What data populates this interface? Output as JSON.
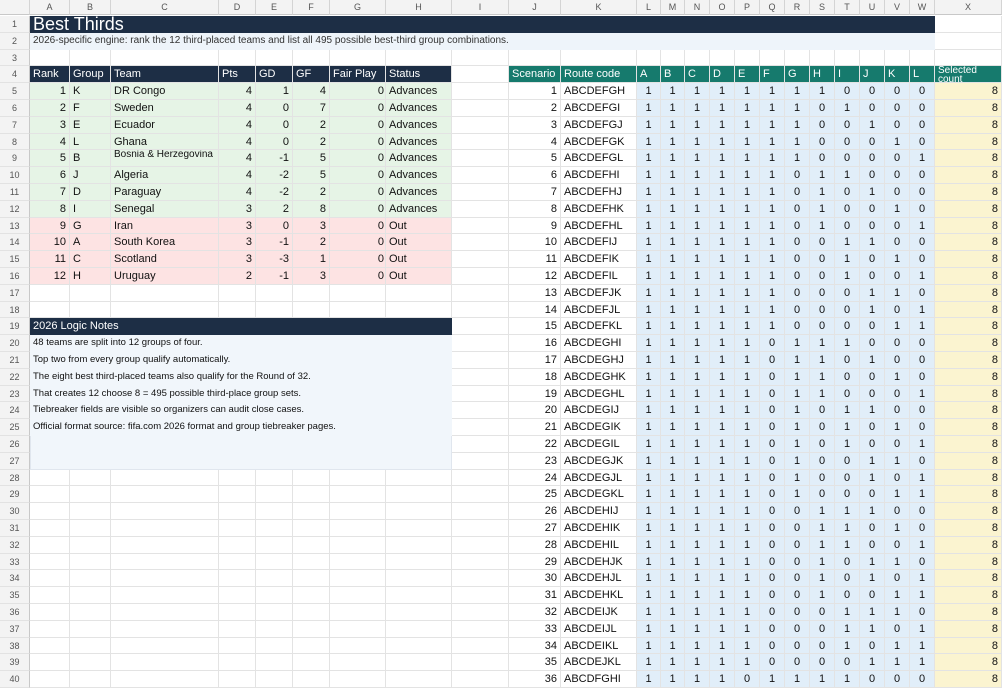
{
  "columns": [
    "A",
    "B",
    "C",
    "D",
    "E",
    "F",
    "G",
    "H",
    "I",
    "J",
    "K",
    "L",
    "M",
    "N",
    "O",
    "P",
    "Q",
    "R",
    "S",
    "T",
    "U",
    "V",
    "W",
    "X"
  ],
  "rows": 40,
  "title": "Best Thirds",
  "subtitle": "2026-specific engine: rank the 12 third-placed teams and list all 495 possible best-third group combinations.",
  "standings": {
    "headers": [
      "Rank",
      "Group",
      "Team",
      "Pts",
      "GD",
      "GF",
      "Fair Play",
      "Status"
    ],
    "rows": [
      [
        1,
        "K",
        "DR Congo",
        4,
        1,
        4,
        0,
        "Advances"
      ],
      [
        2,
        "F",
        "Sweden",
        4,
        0,
        7,
        0,
        "Advances"
      ],
      [
        3,
        "E",
        "Ecuador",
        4,
        0,
        2,
        0,
        "Advances"
      ],
      [
        4,
        "L",
        "Ghana",
        4,
        0,
        2,
        0,
        "Advances"
      ],
      [
        5,
        "B",
        "Bosnia & Herzegovina",
        4,
        -1,
        5,
        0,
        "Advances"
      ],
      [
        6,
        "J",
        "Algeria",
        4,
        -2,
        5,
        0,
        "Advances"
      ],
      [
        7,
        "D",
        "Paraguay",
        4,
        -2,
        2,
        0,
        "Advances"
      ],
      [
        8,
        "I",
        "Senegal",
        3,
        2,
        8,
        0,
        "Advances"
      ],
      [
        9,
        "G",
        "Iran",
        3,
        0,
        3,
        0,
        "Out"
      ],
      [
        10,
        "A",
        "South Korea",
        3,
        -1,
        2,
        0,
        "Out"
      ],
      [
        11,
        "C",
        "Scotland",
        3,
        -3,
        1,
        0,
        "Out"
      ],
      [
        12,
        "H",
        "Uruguay",
        2,
        -1,
        3,
        0,
        "Out"
      ]
    ]
  },
  "notes": {
    "title": "2026 Logic Notes",
    "lines": [
      "48 teams are split into 12 groups of four.",
      "Top two from every group qualify automatically.",
      "The eight best third-placed teams also qualify for the Round of 32.",
      "That creates 12 choose 8 = 495 possible third-place group sets.",
      "Tiebreaker fields are visible so organizers can audit close cases.",
      "Official format source: fifa.com 2026 format and group tiebreaker pages."
    ]
  },
  "scenarios": {
    "headers": [
      "Scenario",
      "Route code",
      "A",
      "B",
      "C",
      "D",
      "E",
      "F",
      "G",
      "H",
      "I",
      "J",
      "K",
      "L",
      "Selected count"
    ],
    "rows": [
      [
        1,
        "ABCDEFGH",
        1,
        1,
        1,
        1,
        1,
        1,
        1,
        1,
        0,
        0,
        0,
        0,
        8
      ],
      [
        2,
        "ABCDEFGI",
        1,
        1,
        1,
        1,
        1,
        1,
        1,
        0,
        1,
        0,
        0,
        0,
        8
      ],
      [
        3,
        "ABCDEFGJ",
        1,
        1,
        1,
        1,
        1,
        1,
        1,
        0,
        0,
        1,
        0,
        0,
        8
      ],
      [
        4,
        "ABCDEFGK",
        1,
        1,
        1,
        1,
        1,
        1,
        1,
        0,
        0,
        0,
        1,
        0,
        8
      ],
      [
        5,
        "ABCDEFGL",
        1,
        1,
        1,
        1,
        1,
        1,
        1,
        0,
        0,
        0,
        0,
        1,
        8
      ],
      [
        6,
        "ABCDEFHI",
        1,
        1,
        1,
        1,
        1,
        1,
        0,
        1,
        1,
        0,
        0,
        0,
        8
      ],
      [
        7,
        "ABCDEFHJ",
        1,
        1,
        1,
        1,
        1,
        1,
        0,
        1,
        0,
        1,
        0,
        0,
        8
      ],
      [
        8,
        "ABCDEFHK",
        1,
        1,
        1,
        1,
        1,
        1,
        0,
        1,
        0,
        0,
        1,
        0,
        8
      ],
      [
        9,
        "ABCDEFHL",
        1,
        1,
        1,
        1,
        1,
        1,
        0,
        1,
        0,
        0,
        0,
        1,
        8
      ],
      [
        10,
        "ABCDEFIJ",
        1,
        1,
        1,
        1,
        1,
        1,
        0,
        0,
        1,
        1,
        0,
        0,
        8
      ],
      [
        11,
        "ABCDEFIK",
        1,
        1,
        1,
        1,
        1,
        1,
        0,
        0,
        1,
        0,
        1,
        0,
        8
      ],
      [
        12,
        "ABCDEFIL",
        1,
        1,
        1,
        1,
        1,
        1,
        0,
        0,
        1,
        0,
        0,
        1,
        8
      ],
      [
        13,
        "ABCDEFJK",
        1,
        1,
        1,
        1,
        1,
        1,
        0,
        0,
        0,
        1,
        1,
        0,
        8
      ],
      [
        14,
        "ABCDEFJL",
        1,
        1,
        1,
        1,
        1,
        1,
        0,
        0,
        0,
        1,
        0,
        1,
        8
      ],
      [
        15,
        "ABCDEFKL",
        1,
        1,
        1,
        1,
        1,
        1,
        0,
        0,
        0,
        0,
        1,
        1,
        8
      ],
      [
        16,
        "ABCDEGHI",
        1,
        1,
        1,
        1,
        1,
        0,
        1,
        1,
        1,
        0,
        0,
        0,
        8
      ],
      [
        17,
        "ABCDEGHJ",
        1,
        1,
        1,
        1,
        1,
        0,
        1,
        1,
        0,
        1,
        0,
        0,
        8
      ],
      [
        18,
        "ABCDEGHK",
        1,
        1,
        1,
        1,
        1,
        0,
        1,
        1,
        0,
        0,
        1,
        0,
        8
      ],
      [
        19,
        "ABCDEGHL",
        1,
        1,
        1,
        1,
        1,
        0,
        1,
        1,
        0,
        0,
        0,
        1,
        8
      ],
      [
        20,
        "ABCDEGIJ",
        1,
        1,
        1,
        1,
        1,
        0,
        1,
        0,
        1,
        1,
        0,
        0,
        8
      ],
      [
        21,
        "ABCDEGIK",
        1,
        1,
        1,
        1,
        1,
        0,
        1,
        0,
        1,
        0,
        1,
        0,
        8
      ],
      [
        22,
        "ABCDEGIL",
        1,
        1,
        1,
        1,
        1,
        0,
        1,
        0,
        1,
        0,
        0,
        1,
        8
      ],
      [
        23,
        "ABCDEGJK",
        1,
        1,
        1,
        1,
        1,
        0,
        1,
        0,
        0,
        1,
        1,
        0,
        8
      ],
      [
        24,
        "ABCDEGJL",
        1,
        1,
        1,
        1,
        1,
        0,
        1,
        0,
        0,
        1,
        0,
        1,
        8
      ],
      [
        25,
        "ABCDEGKL",
        1,
        1,
        1,
        1,
        1,
        0,
        1,
        0,
        0,
        0,
        1,
        1,
        8
      ],
      [
        26,
        "ABCDEHIJ",
        1,
        1,
        1,
        1,
        1,
        0,
        0,
        1,
        1,
        1,
        0,
        0,
        8
      ],
      [
        27,
        "ABCDEHIK",
        1,
        1,
        1,
        1,
        1,
        0,
        0,
        1,
        1,
        0,
        1,
        0,
        8
      ],
      [
        28,
        "ABCDEHIL",
        1,
        1,
        1,
        1,
        1,
        0,
        0,
        1,
        1,
        0,
        0,
        1,
        8
      ],
      [
        29,
        "ABCDEHJK",
        1,
        1,
        1,
        1,
        1,
        0,
        0,
        1,
        0,
        1,
        1,
        0,
        8
      ],
      [
        30,
        "ABCDEHJL",
        1,
        1,
        1,
        1,
        1,
        0,
        0,
        1,
        0,
        1,
        0,
        1,
        8
      ],
      [
        31,
        "ABCDEHKL",
        1,
        1,
        1,
        1,
        1,
        0,
        0,
        1,
        0,
        0,
        1,
        1,
        8
      ],
      [
        32,
        "ABCDEIJK",
        1,
        1,
        1,
        1,
        1,
        0,
        0,
        0,
        1,
        1,
        1,
        0,
        8
      ],
      [
        33,
        "ABCDEIJL",
        1,
        1,
        1,
        1,
        1,
        0,
        0,
        0,
        1,
        1,
        0,
        1,
        8
      ],
      [
        34,
        "ABCDEIKL",
        1,
        1,
        1,
        1,
        1,
        0,
        0,
        0,
        1,
        0,
        1,
        1,
        8
      ],
      [
        35,
        "ABCDEJKL",
        1,
        1,
        1,
        1,
        1,
        0,
        0,
        0,
        0,
        1,
        1,
        1,
        8
      ],
      [
        36,
        "ABCDFGHI",
        1,
        1,
        1,
        1,
        0,
        1,
        1,
        1,
        1,
        0,
        0,
        0,
        8
      ]
    ]
  },
  "colors": {
    "navy": "#1d2e45",
    "teal": "#167a6d",
    "advance_fill": "#e6f4e6",
    "out_fill": "#fde3e3",
    "flag_fill": "#e1eef9",
    "count_fill": "#fbf4d0"
  }
}
